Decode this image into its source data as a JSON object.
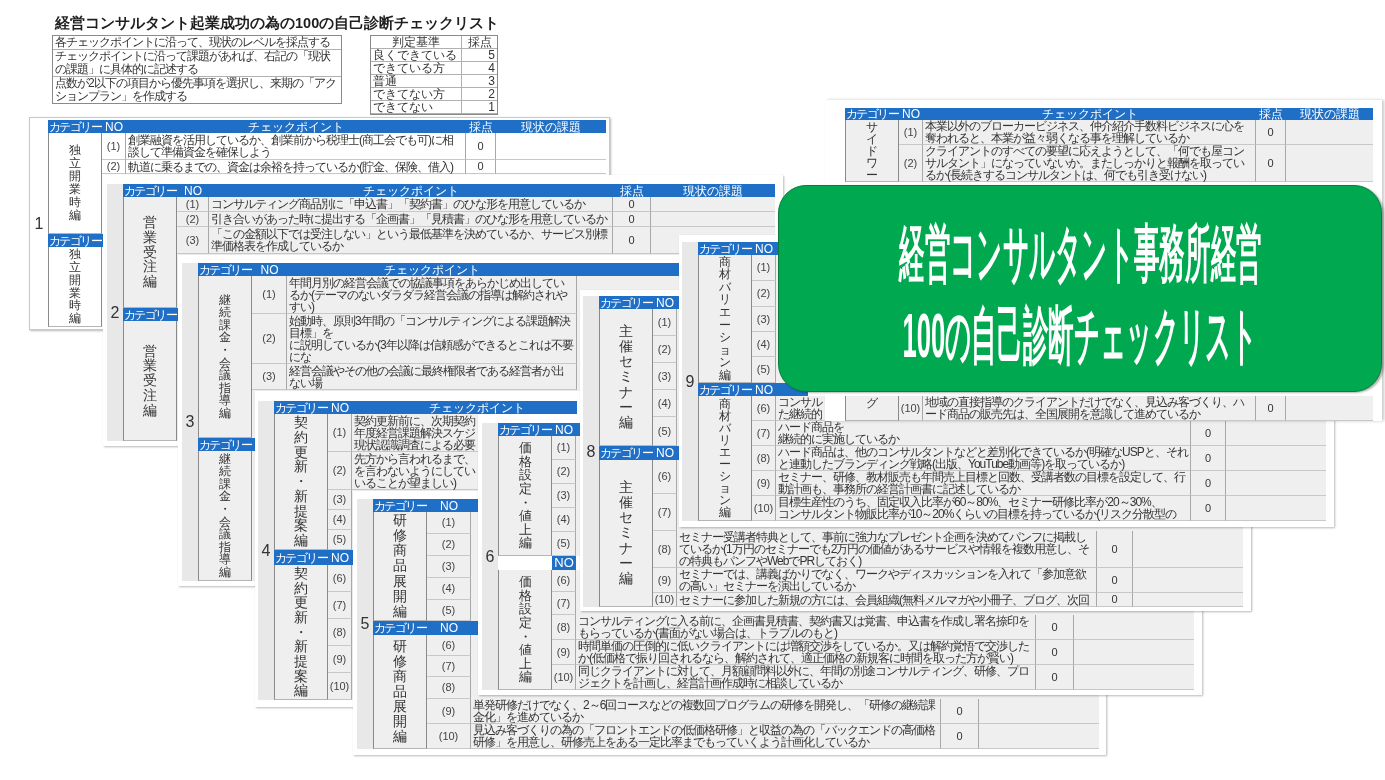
{
  "title": "経営コンサルタント起業成功の為の100の自己診断チェックリスト",
  "instructions": [
    "各チェックポイントに沿って、現状のレベルを採点する",
    "チェックポイントに沿って課題があれば、右記の「現状の課題」に具体的に記述する",
    "点数が2以下の項目から優先事項を選択し、来期の「アクションプラン」を作成する"
  ],
  "criteria": {
    "columns": [
      "判定基準",
      "採点"
    ],
    "rows": [
      {
        "label": "良くできている",
        "score": "5"
      },
      {
        "label": "できている方",
        "score": "4"
      },
      {
        "label": "普通",
        "score": "3"
      },
      {
        "label": "できてない方",
        "score": "2"
      },
      {
        "label": "できてない",
        "score": "1"
      }
    ]
  },
  "sheets": [
    {
      "number": "1",
      "sections": [
        {
          "header": {
            "category": "カテゴリー",
            "no": "NO",
            "checkpoint": "チェックポイント",
            "score": "採点",
            "status": "現状の課題"
          },
          "category": "独立開業時編",
          "rows": [
            {
              "no": "(1)",
              "text": "創業融資を活用しているか、創業前から税理士(商工会でも可)に相談して準備資金を確保しよう",
              "score": "0"
            },
            {
              "no": "(2)",
              "text": "軌道に乗るまでの、資金は余裕を持っているか(貯金、保険、借入)",
              "score": "0"
            }
          ]
        },
        {
          "header": {
            "category": "カテゴリー"
          },
          "category": "独立開業時編"
        }
      ]
    },
    {
      "number": "2",
      "sections": [
        {
          "header": {
            "category": "カテゴリー",
            "no": "NO",
            "checkpoint": "チェックポイント",
            "score": "採点",
            "status": "現状の課題"
          },
          "category": "営業受注編",
          "rows": [
            {
              "no": "(1)",
              "text": "コンサルティング商品別に「申込書」「契約書」のひな形を用意しているか",
              "score": "0"
            },
            {
              "no": "(2)",
              "text": "引き合いがあった時に提出する「企画書」「見積書」のひな形を用意しているか",
              "score": "0"
            },
            {
              "no": "(3)",
              "text": "「この金額以下では受注しない」という最低基準を決めているか、サービス別標準価格表を作成しているか",
              "score": "0"
            }
          ]
        },
        {
          "header": {
            "category": "カテゴリー"
          },
          "category": "営業受注編"
        }
      ]
    },
    {
      "number": "3",
      "sections": [
        {
          "header": {
            "category": "カテゴリー",
            "no": "NO",
            "checkpoint": "チェックポイント"
          },
          "category": "継続課金・会議指導編",
          "rows": [
            {
              "no": "(1)",
              "text": "年間月別の経営会議での協議事項をあらかじめ出しているか(テーマのないダラダラ経営会議の指導は解約されやすい)"
            },
            {
              "no": "(2)",
              "lines": [
                "始動時、原則3年間の「コンサルティングによる課題解決目標」を",
                "に説明しているか(3年以降は信頼感ができるとこれは不要にな"
              ]
            },
            {
              "no": "(3)",
              "lines": [
                "経営会議やその他の会議に最終権限者である経営者が出ない場"
              ]
            }
          ]
        },
        {
          "header": {
            "category": "カテゴリー"
          },
          "category": "継続課金・会議指導編"
        }
      ]
    },
    {
      "number": "4",
      "sections": [
        {
          "header": {
            "category": "カテゴリー",
            "no": "NO",
            "checkpoint": "チェックポイント"
          },
          "category": "契約更新・新提案編",
          "rows": [
            {
              "no": "(1)",
              "lines": [
                "契約更新前に、次期契約",
                "年度経営課題解決スケジ",
                "現状認識調査による必要"
              ]
            },
            {
              "no": "(2)",
              "lines": [
                "先方から言われるまで、",
                "を言わないようにしてい",
                "いることが望ましい)"
              ]
            },
            {
              "no": "(3)"
            },
            {
              "no": "(4)"
            },
            {
              "no": "(5)"
            }
          ]
        },
        {
          "header": {
            "category": "カテゴリー",
            "no": "NO"
          },
          "category": "契約更新・新提案編",
          "rows": [
            {
              "no": "(6)"
            },
            {
              "no": "(7)"
            },
            {
              "no": "(8)"
            },
            {
              "no": "(9)"
            },
            {
              "no": "(10)"
            }
          ]
        }
      ]
    },
    {
      "number": "5",
      "sections": [
        {
          "header": {
            "category": "カテゴリー",
            "no": "NO"
          },
          "category": "研修商品展開編",
          "rows": [
            {
              "no": "(1)"
            },
            {
              "no": "(2)"
            },
            {
              "no": "(3)"
            },
            {
              "no": "(4)"
            },
            {
              "no": "(5)"
            }
          ]
        },
        {
          "header": {
            "category": "カテゴリー",
            "no": "NO"
          },
          "category": "研修商品展開編",
          "rows": [
            {
              "no": "(6)"
            },
            {
              "no": "(7)"
            },
            {
              "no": "(8)"
            },
            {
              "no": "(9)",
              "text": "単発研修だけでなく、2～6回コースなどの複数回プログラムの研修を開発し、「研修の継続課金化」を進めているか",
              "score": "0"
            },
            {
              "no": "(10)",
              "text": "見込み客づくりの為の「フロントエンドの低価格研修」と収益の為の「バックエンドの高価格研修」を用意し、研修売上をある一定比率までもっていくよう計画化しているか",
              "score": "0"
            }
          ]
        }
      ]
    },
    {
      "number": "6",
      "sections": [
        {
          "header": {
            "category": "カテゴリー",
            "no": "NO"
          },
          "category": "価格設定・値上編",
          "rows": [
            {
              "no": "(1)"
            },
            {
              "no": "(2)"
            },
            {
              "no": "(3)"
            },
            {
              "no": "(4)"
            },
            {
              "no": "(5)"
            }
          ]
        },
        {
          "header": {
            "no": "NO"
          },
          "category": "価格設定・値上編",
          "rows": [
            {
              "no": "(6)"
            },
            {
              "no": "(7)"
            },
            {
              "no": "(8)",
              "text": "コンサルティングに入る前に、企画書見積書、契約書又は覚書、申込書を作成し署名捺印をもらっているか(書面がない場合は、トラブルのもと)",
              "score": "0"
            },
            {
              "no": "(9)",
              "text": "時間単価の圧倒的に低いクライアントには増額交渉をしているか。又は解約覚悟で交渉したか(低価格で振り回されるなら、解約されて、適正価格の新規客に時間を取った方が賢い)",
              "score": "0"
            },
            {
              "no": "(10)",
              "text": "同じクライアントに対して、月額顧問料以外に、年間の別途コンサルティング、研修、プロジェクトを計画し、経営計画作成時に相談しているか",
              "score": "0"
            }
          ]
        }
      ]
    },
    {
      "number": "8",
      "sections": [
        {
          "header": {
            "category": "カテゴリー",
            "no": "NO"
          },
          "category": "主催セミナー編",
          "rows": [
            {
              "no": "(1)"
            },
            {
              "no": "(2)"
            },
            {
              "no": "(3)"
            },
            {
              "no": "(4)"
            },
            {
              "no": "(5)"
            }
          ]
        },
        {
          "header": {
            "category": "カテゴリー",
            "no": "NO"
          },
          "category": "主催セミナー編",
          "rows": [
            {
              "no": "(6)"
            },
            {
              "no": "(7)"
            },
            {
              "no": "(8)",
              "text": "セミナー受講者特典として、事前に強力なプレゼント企画を決めてパンフに掲載しているか(1万円のセミナーでも2万円の価値があるサービスや情報を複数用意し、その特典もパンフやWebでPRしておく)",
              "score": "0"
            },
            {
              "no": "(9)",
              "text": "セミナーでは、講義ばかりでなく、ワークやディスカッションを入れて「参加意欲の高い」セミナーを演出しているか",
              "score": "0"
            },
            {
              "no": "(10)",
              "text": "セミナーに参加した新規の方には、会員組織(無料メルマガや小冊子、ブログ、次回",
              "score": "0"
            }
          ]
        }
      ]
    },
    {
      "number": "9",
      "sections": [
        {
          "header": {
            "category": "カテゴリー",
            "no": "NO"
          },
          "category": "商材バリエーション編",
          "rows": [
            {
              "no": "(1)"
            },
            {
              "no": "(2)"
            },
            {
              "no": "(3)"
            },
            {
              "no": "(4)"
            },
            {
              "no": "(5)"
            }
          ]
        },
        {
          "header": {
            "category": "カテゴリー",
            "no": "NO"
          },
          "category": "商材バリエーション編",
          "rows": [
            {
              "no": "(6)",
              "lines": [
                "コンサル",
                "た継続的"
              ]
            },
            {
              "no": "(7)",
              "lines": [
                "ハード商品を",
                "継続的に実施しているか"
              ],
              "score": "0"
            },
            {
              "no": "(8)",
              "text": "ハード商品は、他のコンサルタントなどと差別化できているか(明確なUSPと、それと連動したブランディング戦略(出版、YouTube動画等)を取っているか)",
              "score": "0"
            },
            {
              "no": "(9)",
              "text": "セミナー、研修、教材販売も年間売上目標と回数、受講者数の目標を設定して、行動計画も、事務所の経営計画書に記述しているか",
              "score": "0"
            },
            {
              "no": "(10)",
              "lines": [
                "目標生産性のうち、固定収入比率が60～80%、セミナー研修比率が20～30%、",
                "コンサルタント物販比率が10～20%くらいの目標を持っているか(リスク分散型の"
              ],
              "score": "0"
            }
          ]
        }
      ]
    },
    {
      "sections": [
        {
          "header": {
            "category": "カテゴリー",
            "no": "NO",
            "checkpoint": "チェックポイント",
            "score": "採点",
            "status": "現状の課題"
          },
          "category": "サイドワー",
          "rows": [
            {
              "no": "(1)",
              "text": "本業以外のブローカービジネス、仲介紹介手数料ビジネスに心を奪われると、本業が益々弱くなる事を理解しているか",
              "score": "0"
            },
            {
              "no": "(2)",
              "text": "クライアントのすべての要望に応えようとして、「何でも屋コンサルタント」になっていないか。またしっかりと報酬を取っているか(長続きするコンサルタントは、何でも引き受けない)",
              "score": "0"
            }
          ]
        },
        {
          "category": "グ",
          "rows": [
            {
              "no": "(10)",
              "text": "地域の直接指導のクライアントだけでなく、見込み客づくり、ハード商品の販売先は、全国展開を意識して進めているか",
              "score": "0"
            }
          ]
        }
      ]
    }
  ],
  "banner": {
    "lines": [
      "経営コンサルタント事務所経営",
      "100の自己診断チェックリスト"
    ]
  }
}
